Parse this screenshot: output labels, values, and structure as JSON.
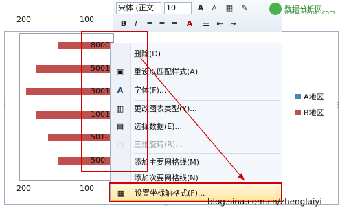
{
  "chart_data": {
    "type": "bar",
    "categories": [
      "8000",
      "5001-",
      "3001-",
      "1001-",
      "501-",
      "500"
    ],
    "series": [
      {
        "name": "A地区",
        "values": [
          0,
          0,
          0,
          0,
          0,
          0
        ]
      },
      {
        "name": "B地区",
        "values": [
          118,
          165,
          185,
          165,
          138,
          118
        ]
      }
    ],
    "axis": {
      "ticks_top": [
        "200",
        "100"
      ],
      "ticks_bottom": [
        "200",
        "100"
      ],
      "xlim": [
        200,
        0
      ]
    },
    "legend_position": "right",
    "colors": {
      "series_a": "#4f81bd",
      "series_b": "#c0504d"
    }
  },
  "legend": {
    "a_label": "A地区",
    "b_label": "B地区"
  },
  "mini_toolbar": {
    "font_family_value": "宋体 (正文",
    "font_size_value": "10",
    "bold_label": "B",
    "italic_label": "I",
    "font_color_label": "A",
    "grow_font_label": "A",
    "shrink_font_label": "A"
  },
  "context_menu": {
    "items": [
      {
        "label": "删除(D)",
        "disabled": false
      },
      {
        "label": "重设以匹配样式(A)",
        "disabled": false
      },
      {
        "label": "字体(F)...",
        "disabled": false
      },
      {
        "label": "更改图表类型(Y)...",
        "disabled": false
      },
      {
        "label": "选择数据(E)...",
        "disabled": false
      },
      {
        "label": "三维旋转(R)...",
        "disabled": true
      },
      {
        "label": "添加主要网格线(M)",
        "disabled": false
      },
      {
        "label": "添加次要网格线(N)",
        "disabled": false
      },
      {
        "label": "设置坐标轴格式(F)...",
        "disabled": false
      }
    ]
  },
  "watermark": {
    "title": "数据分析网",
    "url": "www.afenxi.com"
  },
  "blog_text": "blog.sina.com.cn/zhenglaiyi"
}
